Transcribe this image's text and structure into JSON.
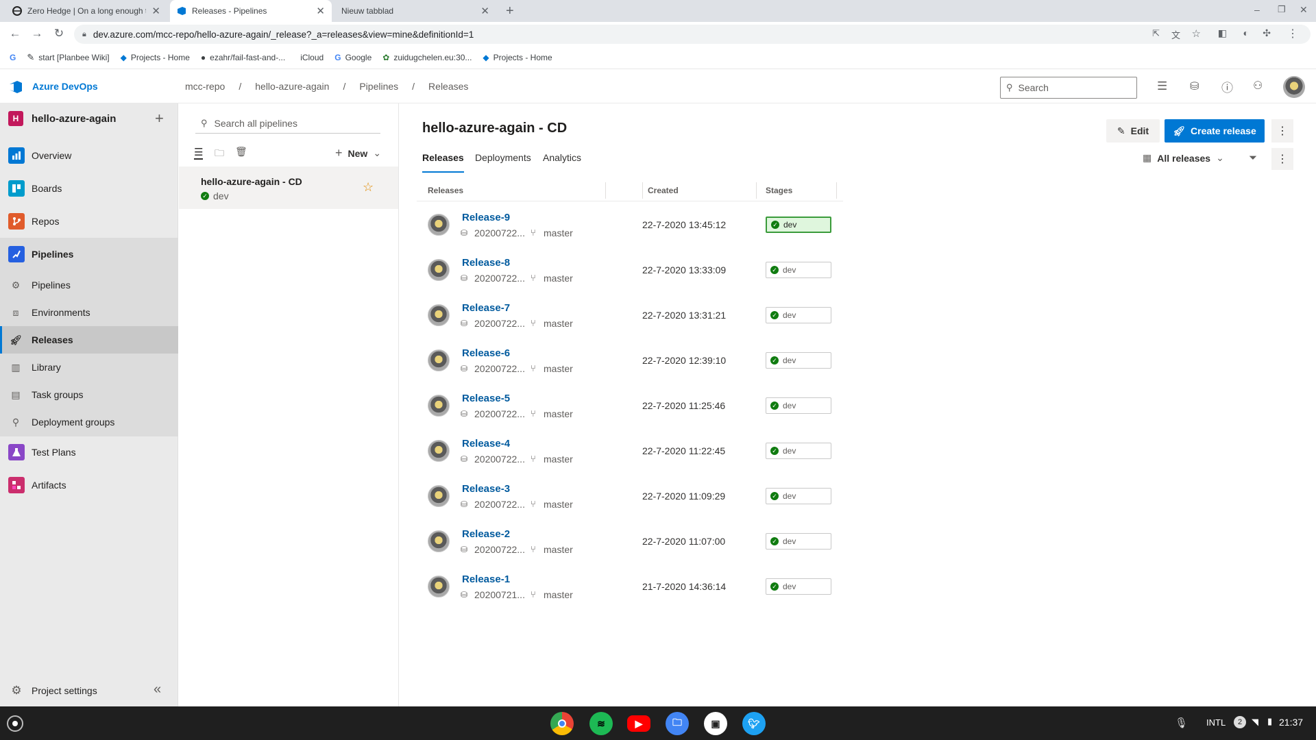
{
  "browser": {
    "tabs": [
      {
        "title": "Zero Hedge | On a long enough t",
        "favicon": "zerohedge-icon",
        "active": false
      },
      {
        "title": "Releases - Pipelines",
        "favicon": "azure-devops-icon",
        "active": true
      },
      {
        "title": "Nieuw tabblad",
        "favicon": "",
        "active": false
      }
    ],
    "url": "dev.azure.com/mcc-repo/hello-azure-again/_release?_a=releases&view=mine&definitionId=1",
    "bookmarks": [
      {
        "label": "",
        "icon": "google-icon"
      },
      {
        "label": "start [Planbee Wiki]",
        "icon": "wiki-icon"
      },
      {
        "label": "Projects - Home",
        "icon": "azure-devops-icon"
      },
      {
        "label": "ezahr/fail-fast-and-...",
        "icon": "github-icon"
      },
      {
        "label": "iCloud",
        "icon": "apple-icon"
      },
      {
        "label": "Google",
        "icon": "google-icon"
      },
      {
        "label": "zuidugchelen.eu:30...",
        "icon": "site-icon"
      },
      {
        "label": "Projects - Home",
        "icon": "azure-devops-icon"
      }
    ]
  },
  "header": {
    "brand": "Azure DevOps",
    "breadcrumb": [
      "mcc-repo",
      "hello-azure-again",
      "Pipelines",
      "Releases"
    ],
    "search_placeholder": "Search"
  },
  "sidebar": {
    "project_initial": "H",
    "project_name": "hello-azure-again",
    "items": [
      {
        "label": "Overview",
        "icon": "overview-icon",
        "color": "#0078d4"
      },
      {
        "label": "Boards",
        "icon": "boards-icon",
        "color": "#009ccc"
      },
      {
        "label": "Repos",
        "icon": "repos-icon",
        "color": "#e05b2b"
      },
      {
        "label": "Pipelines",
        "icon": "pipelines-icon",
        "color": "#2560e0"
      },
      {
        "label": "Test Plans",
        "icon": "test-plans-icon",
        "color": "#8a47c7"
      },
      {
        "label": "Artifacts",
        "icon": "artifacts-icon",
        "color": "#cb2e6d"
      }
    ],
    "pipeline_subitems": [
      {
        "label": "Pipelines",
        "icon": "pipelines-sub-icon"
      },
      {
        "label": "Environments",
        "icon": "environments-icon"
      },
      {
        "label": "Releases",
        "icon": "releases-icon"
      },
      {
        "label": "Library",
        "icon": "library-icon"
      },
      {
        "label": "Task groups",
        "icon": "task-groups-icon"
      },
      {
        "label": "Deployment groups",
        "icon": "deployment-groups-icon"
      }
    ],
    "footer_label": "Project settings"
  },
  "midpane": {
    "search_placeholder": "Search all pipelines",
    "new_label": "New",
    "pipeline_name": "hello-azure-again - CD",
    "pipeline_stage": "dev"
  },
  "main": {
    "title": "hello-azure-again - CD",
    "edit_label": "Edit",
    "create_release_label": "Create release",
    "tabs": [
      "Releases",
      "Deployments",
      "Analytics"
    ],
    "view_selector": "All releases",
    "columns": [
      "Releases",
      "Created",
      "Stages"
    ],
    "releases": [
      {
        "name": "Release-9",
        "build": "20200722...",
        "branch": "master",
        "created": "22-7-2020 13:45:12",
        "stage": "dev"
      },
      {
        "name": "Release-8",
        "build": "20200722...",
        "branch": "master",
        "created": "22-7-2020 13:33:09",
        "stage": "dev"
      },
      {
        "name": "Release-7",
        "build": "20200722...",
        "branch": "master",
        "created": "22-7-2020 13:31:21",
        "stage": "dev"
      },
      {
        "name": "Release-6",
        "build": "20200722...",
        "branch": "master",
        "created": "22-7-2020 12:39:10",
        "stage": "dev"
      },
      {
        "name": "Release-5",
        "build": "20200722...",
        "branch": "master",
        "created": "22-7-2020 11:25:46",
        "stage": "dev"
      },
      {
        "name": "Release-4",
        "build": "20200722...",
        "branch": "master",
        "created": "22-7-2020 11:22:45",
        "stage": "dev"
      },
      {
        "name": "Release-3",
        "build": "20200722...",
        "branch": "master",
        "created": "22-7-2020 11:09:29",
        "stage": "dev"
      },
      {
        "name": "Release-2",
        "build": "20200722...",
        "branch": "master",
        "created": "22-7-2020 11:07:00",
        "stage": "dev"
      },
      {
        "name": "Release-1",
        "build": "20200721...",
        "branch": "master",
        "created": "21-7-2020 14:36:14",
        "stage": "dev"
      }
    ]
  },
  "taskbar": {
    "apps": [
      "chrome-icon",
      "spotify-icon",
      "youtube-icon",
      "files-icon",
      "app-icon",
      "twitter-icon"
    ],
    "locale": "INTL",
    "notification_count": "2",
    "time": "21:37"
  },
  "colors": {
    "accent": "#0078d4",
    "success": "#107c10",
    "link": "#005a9e"
  }
}
